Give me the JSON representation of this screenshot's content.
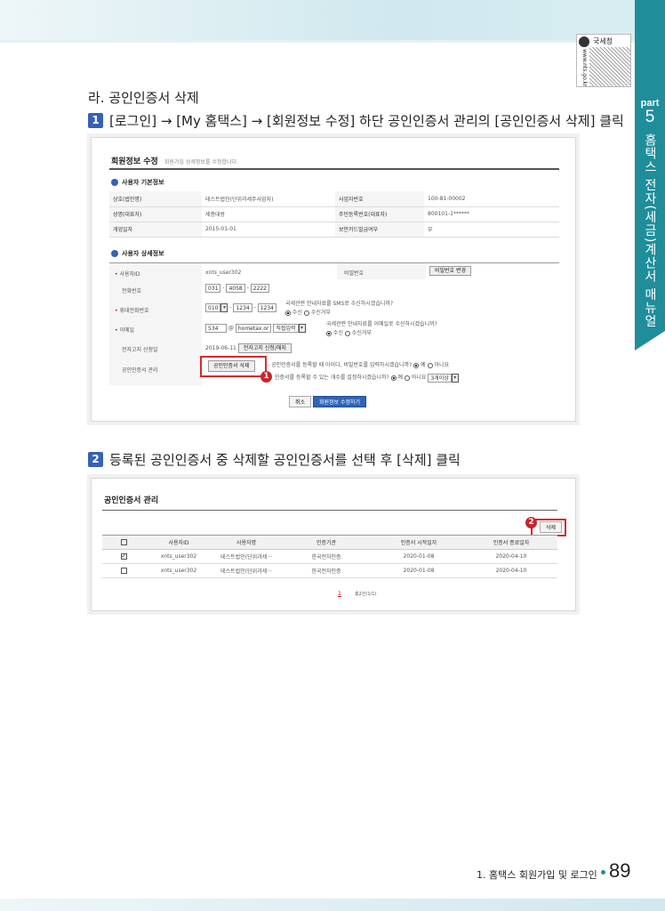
{
  "header": {
    "qr_label": "국세청",
    "qr_side": "www.nts.go.kr"
  },
  "side_tab": {
    "part_label": "part",
    "part_number": "5",
    "title": "홈택스 전자(세금)계산서 매뉴얼"
  },
  "heading": "라. 공인인증서 삭제",
  "step1": {
    "num": "1",
    "text": "[로그인] → [My 홈택스] → [회원정보 수정] 하단 공인인증서 관리의 [공인인증서 삭제] 클릭"
  },
  "form": {
    "title": "회원정보 수정",
    "subtitle": "회원가입 상세정보를 수정합니다.",
    "basic_section": "사용자 기본정보",
    "basic_rows": [
      {
        "k1": "상호(법인명)",
        "v1": "테스트법인(단위과세주사업자)",
        "k2": "사업자번호",
        "v2": "100-81-00002"
      },
      {
        "k1": "성명(대표자)",
        "v1": "세종대왕",
        "k2": "주민등록번호(대표자)",
        "v2": "800101-1******"
      },
      {
        "k1": "개업일자",
        "v1": "2015-01-01",
        "k2": "보안카드발급여부",
        "v2": "부"
      }
    ],
    "detail_section": "사용자 상세정보",
    "labels": {
      "user_id": "사용자ID",
      "phone": "전화번호",
      "mobile": "휴대전화번호",
      "email": "이메일",
      "einvoice": "전자고지 신청일",
      "cert": "공인인증서 관리",
      "password": "비밀번호"
    },
    "user_id_val": "xnts_user302",
    "password_btn": "비밀번호 변경",
    "phone": [
      "031",
      "4058",
      "2222"
    ],
    "mobile": [
      "010",
      "1234",
      "1234"
    ],
    "sms_q": "국세관련 안내자료를 SMS로 수신하시겠습니까?",
    "email_q": "국세관련 안내자료를 이메일로 수신하시겠습니까?",
    "recv_yes": "수신",
    "recv_no": "수신거부",
    "email": {
      "id": "534",
      "at": "@",
      "domain": "hometax.or",
      "select": "직접입력"
    },
    "einvoice_date": "2019-06-11",
    "einvoice_btn": "전자고지 신청/해지",
    "cert_btn": "공인인증서 삭제",
    "cert_q1": "공인인증서를 등록할 때 아이디, 비밀번호를 입력하시겠습니까?",
    "cert_q2": "인증서를 등록할 수 있는 개수를 설정하시겠습니까?",
    "yes": "예",
    "no": "아니요",
    "count_select": "3개이상",
    "cancel_btn": "취소",
    "submit_btn": "회원정보 수정하기",
    "badge": "1"
  },
  "step2": {
    "num": "2",
    "text": "등록된 공인인증서 중 삭제할 공인인증서를 선택 후 [삭제] 클릭"
  },
  "certs": {
    "title": "공인인증서 관리",
    "delete_btn": "삭제",
    "badge": "2",
    "headers": [
      "사용자ID",
      "사용자명",
      "인증기관",
      "인증서 시작일자",
      "인증서 종료일자"
    ],
    "rows": [
      {
        "checked": true,
        "id": "xnts_user302",
        "name": "테스트법인(단위과세···",
        "ca": "한국전자인증",
        "start": "2020-01-08",
        "end": "2020-04-10"
      },
      {
        "checked": false,
        "id": "xnts_user302",
        "name": "테스트법인(단위과세···",
        "ca": "한국전자인증",
        "start": "2020-01-08",
        "end": "2020-04-10"
      }
    ],
    "page": "1",
    "total": "총2건(1/1)"
  },
  "footer": {
    "text": "1. 홈택스 회원가입 및 로그인",
    "page": "89"
  }
}
